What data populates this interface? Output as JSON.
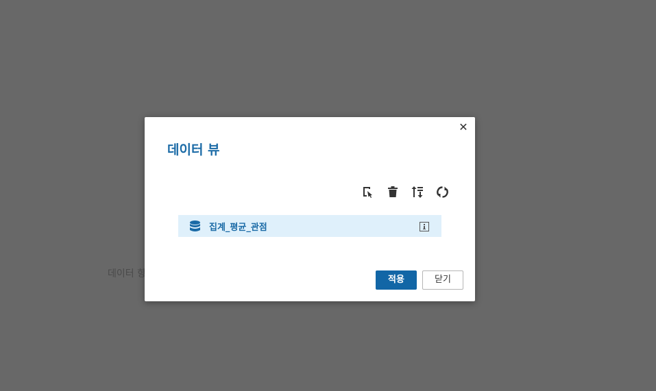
{
  "background": {
    "partial_text": "데이터 항"
  },
  "dialog": {
    "title": "데이터 뷰",
    "close_symbol": "✕",
    "toolbar": [
      {
        "name": "edit-icon"
      },
      {
        "name": "trash-icon"
      },
      {
        "name": "sort-icon"
      },
      {
        "name": "refresh-icon"
      }
    ],
    "items": [
      {
        "label": "집계_평균_관점",
        "icon": "database-icon",
        "selected": true
      }
    ],
    "buttons": {
      "apply": "적용",
      "close": "닫기"
    }
  },
  "colors": {
    "accent": "#1a6aa6",
    "primary_button": "#1266a6",
    "selected_row": "#dff0fb",
    "backdrop": "#686868"
  }
}
